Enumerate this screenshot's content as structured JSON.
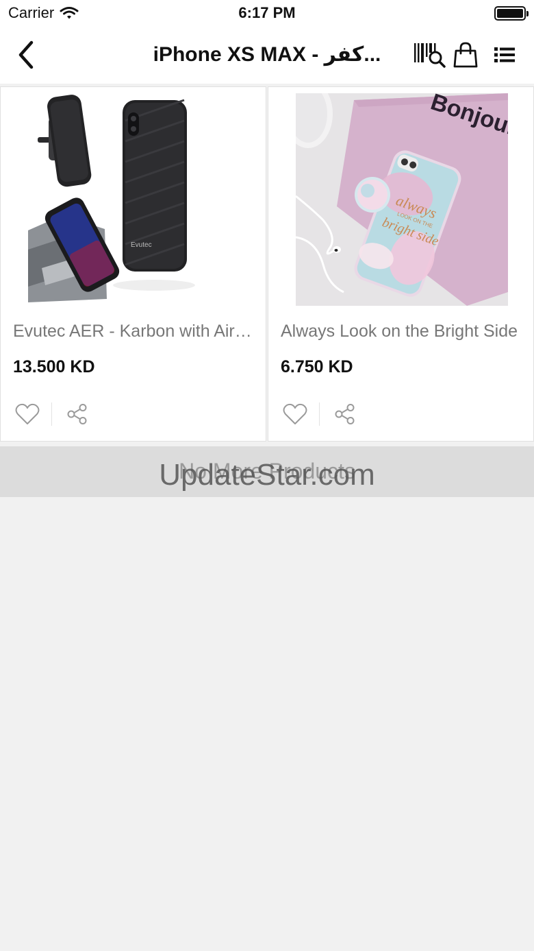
{
  "status_bar": {
    "carrier": "Carrier",
    "time": "6:17 PM"
  },
  "nav": {
    "title": "iPhone XS MAX - كفر...",
    "icons": {
      "back": "chevron-left-icon",
      "scan": "barcode-search-icon",
      "bag": "shopping-bag-icon",
      "list": "list-menu-icon"
    }
  },
  "products": [
    {
      "name": "Evutec AER - Karbon with Air Vent Mount",
      "price": "13.500 KD",
      "image_text": "Evutec"
    },
    {
      "name": "Always Look on the Bright Side",
      "price": "6.750 KD",
      "image_text_1": "Bonjour",
      "image_text_2": "always",
      "image_text_3": "LOOK ON THE",
      "image_text_4": "bright side"
    }
  ],
  "footer": {
    "no_more_text": "No More Products"
  },
  "watermark": "UpdateStar.com",
  "colors": {
    "background": "#f1f1f1",
    "card": "#ffffff",
    "price": "#111111",
    "name": "#777777",
    "banner": "#dcdcdc"
  }
}
